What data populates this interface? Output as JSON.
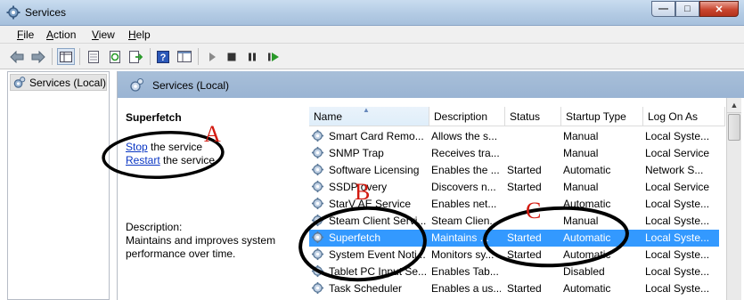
{
  "window": {
    "title": "Services"
  },
  "menu": {
    "items": [
      "File",
      "Action",
      "View",
      "Help"
    ],
    "mnemonics": [
      "F",
      "A",
      "V",
      "H"
    ]
  },
  "toolbar": {
    "icons": [
      "back-icon",
      "forward-icon",
      "show-hide-tree-icon",
      "properties-icon",
      "refresh-icon",
      "export-list-icon",
      "help-icon",
      "console-view-icon",
      "start-service-icon",
      "stop-service-icon",
      "pause-service-icon",
      "restart-service-icon"
    ]
  },
  "tree": {
    "item": "Services (Local)"
  },
  "content": {
    "header": "Services (Local)",
    "selected_service": "Superfetch",
    "actions": [
      {
        "link": "Stop",
        "rest": " the service"
      },
      {
        "link": "Restart",
        "rest": " the service"
      }
    ],
    "description_label": "Description:",
    "description": "Maintains and improves system performance over time."
  },
  "grid": {
    "columns": [
      "Name",
      "Description",
      "Status",
      "Startup Type",
      "Log On As"
    ],
    "sorted_column": "Name",
    "rows": [
      {
        "name": "Smart Card Remo...",
        "description": "Allows the s...",
        "status": "",
        "startup": "Manual",
        "logon": "Local Syste..."
      },
      {
        "name": "SNMP Trap",
        "description": "Receives tra...",
        "status": "",
        "startup": "Manual",
        "logon": "Local Service"
      },
      {
        "name": "Software Licensing",
        "description": "Enables the ...",
        "status": "Started",
        "startup": "Automatic",
        "logon": "Network S..."
      },
      {
        "name": "SSDP      overy",
        "description": "Discovers n...",
        "status": "Started",
        "startup": "Manual",
        "logon": "Local Service"
      },
      {
        "name": "StarV      AE Service",
        "description": "Enables net...",
        "status": "",
        "startup": "Automatic",
        "logon": "Local Syste..."
      },
      {
        "name": "Steam Client Servi...",
        "description": "Steam Clien...",
        "status": "",
        "startup": "Manual",
        "logon": "Local Syste..."
      },
      {
        "name": "Superfetch",
        "description": "Maintains ...",
        "status": "Started",
        "startup": "Automatic",
        "logon": "Local Syste..."
      },
      {
        "name": "System Event Noti...",
        "description": "Monitors sy...",
        "status": "Started",
        "startup": "Automatic",
        "logon": "Local Syste..."
      },
      {
        "name": "Tablet PC Input Se...",
        "description": "Enables Tab...",
        "status": "",
        "startup": "Disabled",
        "logon": "Local Syste..."
      },
      {
        "name": "Task Scheduler",
        "description": "Enables a us...",
        "status": "Started",
        "startup": "Automatic",
        "logon": "Local Syste..."
      }
    ],
    "selected_row": 6
  },
  "annotations": {
    "a": "A",
    "b": "B",
    "c": "C",
    "color": "#d21a10"
  },
  "colors": {
    "selection": "#3399ff",
    "header": "#9ab4d3",
    "link": "#0a36c4"
  }
}
